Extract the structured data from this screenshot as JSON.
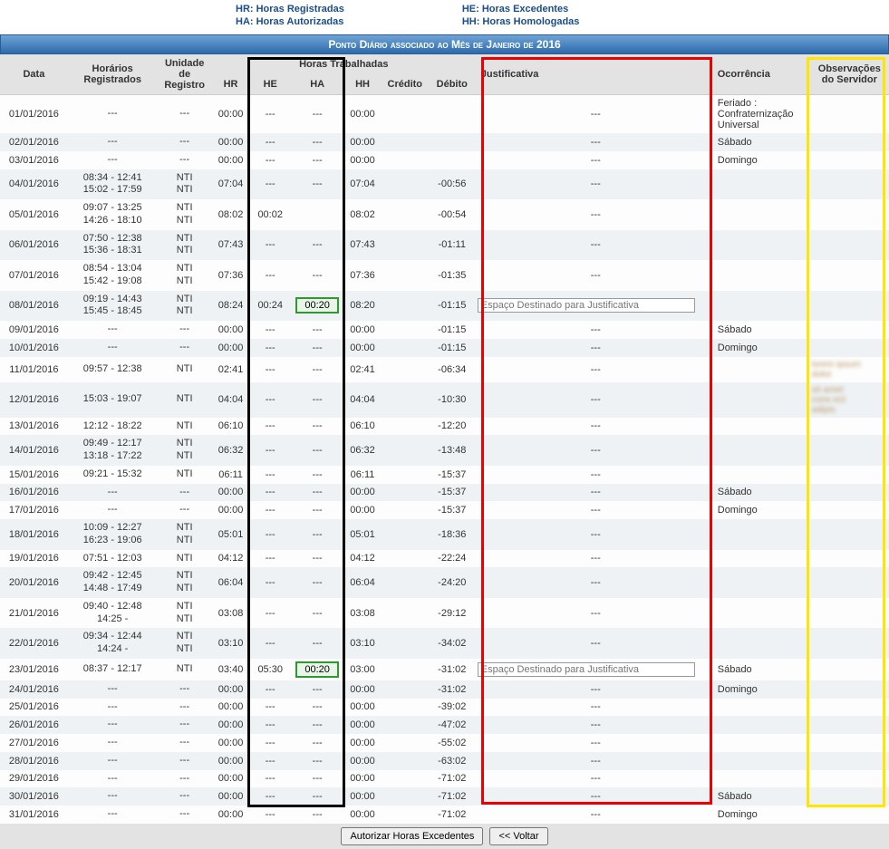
{
  "legend": {
    "hr": "HR: Horas Registradas",
    "ha": "HA: Horas Autorizadas",
    "he": "HE: Horas Excedentes",
    "hh": "HH: Horas Homologadas"
  },
  "title": "Ponto Diário associado ao Mês de Janeiro de 2016",
  "headers": {
    "data": "Data",
    "horarios": "Horários Registrados",
    "unidade": "Unidade de Registro",
    "horas_trab": "Horas Trabalhadas",
    "hr": "HR",
    "he": "HE",
    "ha": "HA",
    "hh": "HH",
    "credito": "Crédito",
    "debito": "Débito",
    "justificativa": "Justificativa",
    "ocorrencia": "Ocorrência",
    "observacoes": "Observações do Servidor"
  },
  "justificativa_placeholder": "Espaço Destinado para Justificativa",
  "buttons": {
    "autorizar": "Autorizar Horas Excedentes",
    "voltar": "<< Voltar"
  },
  "rows": [
    {
      "data": "01/01/2016",
      "hor1": "---",
      "hor2": "",
      "un1": "---",
      "un2": "",
      "hr": "00:00",
      "he": "---",
      "ha": "---",
      "ha_input": false,
      "hh": "00:00",
      "cred": "",
      "deb": "",
      "just": "---",
      "just_input": false,
      "ocor": "Feriado : Confraternização Universal",
      "obs": ""
    },
    {
      "data": "02/01/2016",
      "hor1": "---",
      "hor2": "",
      "un1": "---",
      "un2": "",
      "hr": "00:00",
      "he": "---",
      "ha": "---",
      "ha_input": false,
      "hh": "00:00",
      "cred": "",
      "deb": "",
      "just": "---",
      "just_input": false,
      "ocor": "Sábado",
      "obs": ""
    },
    {
      "data": "03/01/2016",
      "hor1": "---",
      "hor2": "",
      "un1": "---",
      "un2": "",
      "hr": "00:00",
      "he": "---",
      "ha": "---",
      "ha_input": false,
      "hh": "00:00",
      "cred": "",
      "deb": "",
      "just": "---",
      "just_input": false,
      "ocor": "Domingo",
      "obs": ""
    },
    {
      "data": "04/01/2016",
      "hor1": "08:34 - 12:41",
      "hor2": "15:02 - 17:59",
      "un1": "NTI",
      "un2": "NTI",
      "hr": "07:04",
      "he": "---",
      "ha": "---",
      "ha_input": false,
      "hh": "07:04",
      "cred": "",
      "deb": "-00:56",
      "just": "---",
      "just_input": false,
      "ocor": "",
      "obs": ""
    },
    {
      "data": "05/01/2016",
      "hor1": "09:07 - 13:25",
      "hor2": "14:26 - 18:10",
      "un1": "NTI",
      "un2": "NTI",
      "hr": "08:02",
      "he": "00:02",
      "ha": "",
      "ha_input": false,
      "hh": "08:02",
      "cred": "",
      "deb": "-00:54",
      "just": "---",
      "just_input": false,
      "ocor": "",
      "obs": ""
    },
    {
      "data": "06/01/2016",
      "hor1": "07:50 - 12:38",
      "hor2": "15:36 - 18:31",
      "un1": "NTI",
      "un2": "NTI",
      "hr": "07:43",
      "he": "---",
      "ha": "---",
      "ha_input": false,
      "hh": "07:43",
      "cred": "",
      "deb": "-01:11",
      "just": "---",
      "just_input": false,
      "ocor": "",
      "obs": ""
    },
    {
      "data": "07/01/2016",
      "hor1": "08:54 - 13:04",
      "hor2": "15:42 - 19:08",
      "un1": "NTI",
      "un2": "NTI",
      "hr": "07:36",
      "he": "---",
      "ha": "---",
      "ha_input": false,
      "hh": "07:36",
      "cred": "",
      "deb": "-01:35",
      "just": "---",
      "just_input": false,
      "ocor": "",
      "obs": ""
    },
    {
      "data": "08/01/2016",
      "hor1": "09:19 - 14:43",
      "hor2": "15:45 - 18:45",
      "un1": "NTI",
      "un2": "NTI",
      "hr": "08:24",
      "he": "00:24",
      "ha": "00:20",
      "ha_input": true,
      "hh": "08:20",
      "cred": "",
      "deb": "-01:15",
      "just": "",
      "just_input": true,
      "ocor": "",
      "obs": ""
    },
    {
      "data": "09/01/2016",
      "hor1": "---",
      "hor2": "",
      "un1": "---",
      "un2": "",
      "hr": "00:00",
      "he": "---",
      "ha": "---",
      "ha_input": false,
      "hh": "00:00",
      "cred": "",
      "deb": "-01:15",
      "just": "---",
      "just_input": false,
      "ocor": "Sábado",
      "obs": ""
    },
    {
      "data": "10/01/2016",
      "hor1": "---",
      "hor2": "",
      "un1": "---",
      "un2": "",
      "hr": "00:00",
      "he": "---",
      "ha": "---",
      "ha_input": false,
      "hh": "00:00",
      "cred": "",
      "deb": "-01:15",
      "just": "---",
      "just_input": false,
      "ocor": "Domingo",
      "obs": ""
    },
    {
      "data": "11/01/2016",
      "hor1": "09:57 - 12:38",
      "hor2": "",
      "un1": "NTI",
      "un2": "",
      "hr": "02:41",
      "he": "---",
      "ha": "---",
      "ha_input": false,
      "hh": "02:41",
      "cred": "",
      "deb": "-06:34",
      "just": "---",
      "just_input": false,
      "ocor": "",
      "obs": "blur1"
    },
    {
      "data": "12/01/2016",
      "hor1": "15:03 - 19:07",
      "hor2": "",
      "un1": "NTI",
      "un2": "",
      "hr": "04:04",
      "he": "---",
      "ha": "---",
      "ha_input": false,
      "hh": "04:04",
      "cred": "",
      "deb": "-10:30",
      "just": "---",
      "just_input": false,
      "ocor": "",
      "obs": "blur2"
    },
    {
      "data": "13/01/2016",
      "hor1": "12:12 - 18:22",
      "hor2": "",
      "un1": "NTI",
      "un2": "",
      "hr": "06:10",
      "he": "---",
      "ha": "---",
      "ha_input": false,
      "hh": "06:10",
      "cred": "",
      "deb": "-12:20",
      "just": "---",
      "just_input": false,
      "ocor": "",
      "obs": ""
    },
    {
      "data": "14/01/2016",
      "hor1": "09:49 - 12:17",
      "hor2": "13:18 - 17:22",
      "un1": "NTI",
      "un2": "NTI",
      "hr": "06:32",
      "he": "---",
      "ha": "---",
      "ha_input": false,
      "hh": "06:32",
      "cred": "",
      "deb": "-13:48",
      "just": "---",
      "just_input": false,
      "ocor": "",
      "obs": ""
    },
    {
      "data": "15/01/2016",
      "hor1": "09:21 - 15:32",
      "hor2": "",
      "un1": "NTI",
      "un2": "",
      "hr": "06:11",
      "he": "---",
      "ha": "---",
      "ha_input": false,
      "hh": "06:11",
      "cred": "",
      "deb": "-15:37",
      "just": "---",
      "just_input": false,
      "ocor": "",
      "obs": ""
    },
    {
      "data": "16/01/2016",
      "hor1": "---",
      "hor2": "",
      "un1": "---",
      "un2": "",
      "hr": "00:00",
      "he": "---",
      "ha": "---",
      "ha_input": false,
      "hh": "00:00",
      "cred": "",
      "deb": "-15:37",
      "just": "---",
      "just_input": false,
      "ocor": "Sábado",
      "obs": ""
    },
    {
      "data": "17/01/2016",
      "hor1": "---",
      "hor2": "",
      "un1": "---",
      "un2": "",
      "hr": "00:00",
      "he": "---",
      "ha": "---",
      "ha_input": false,
      "hh": "00:00",
      "cred": "",
      "deb": "-15:37",
      "just": "---",
      "just_input": false,
      "ocor": "Domingo",
      "obs": ""
    },
    {
      "data": "18/01/2016",
      "hor1": "10:09 - 12:27",
      "hor2": "16:23 - 19:06",
      "un1": "NTI",
      "un2": "NTI",
      "hr": "05:01",
      "he": "---",
      "ha": "---",
      "ha_input": false,
      "hh": "05:01",
      "cred": "",
      "deb": "-18:36",
      "just": "---",
      "just_input": false,
      "ocor": "",
      "obs": ""
    },
    {
      "data": "19/01/2016",
      "hor1": "07:51 - 12:03",
      "hor2": "",
      "un1": "NTI",
      "un2": "",
      "hr": "04:12",
      "he": "---",
      "ha": "---",
      "ha_input": false,
      "hh": "04:12",
      "cred": "",
      "deb": "-22:24",
      "just": "---",
      "just_input": false,
      "ocor": "",
      "obs": ""
    },
    {
      "data": "20/01/2016",
      "hor1": "09:42 - 12:45",
      "hor2": "14:48 - 17:49",
      "un1": "NTI",
      "un2": "NTI",
      "hr": "06:04",
      "he": "---",
      "ha": "---",
      "ha_input": false,
      "hh": "06:04",
      "cred": "",
      "deb": "-24:20",
      "just": "---",
      "just_input": false,
      "ocor": "",
      "obs": ""
    },
    {
      "data": "21/01/2016",
      "hor1": "09:40 - 12:48",
      "hor2": "14:25 -",
      "un1": "NTI",
      "un2": "NTI",
      "hr": "03:08",
      "he": "---",
      "ha": "---",
      "ha_input": false,
      "hh": "03:08",
      "cred": "",
      "deb": "-29:12",
      "just": "---",
      "just_input": false,
      "ocor": "",
      "obs": ""
    },
    {
      "data": "22/01/2016",
      "hor1": "09:34 - 12:44",
      "hor2": "14:24 -",
      "un1": "NTI",
      "un2": "NTI",
      "hr": "03:10",
      "he": "---",
      "ha": "---",
      "ha_input": false,
      "hh": "03:10",
      "cred": "",
      "deb": "-34:02",
      "just": "---",
      "just_input": false,
      "ocor": "",
      "obs": ""
    },
    {
      "data": "23/01/2016",
      "hor1": "08:37 - 12:17",
      "hor2": "",
      "un1": "NTI",
      "un2": "",
      "hr": "03:40",
      "he": "05:30",
      "ha": "00:20",
      "ha_input": true,
      "hh": "03:00",
      "cred": "",
      "deb": "-31:02",
      "just": "",
      "just_input": true,
      "ocor": "Sábado",
      "obs": ""
    },
    {
      "data": "24/01/2016",
      "hor1": "---",
      "hor2": "",
      "un1": "---",
      "un2": "",
      "hr": "00:00",
      "he": "---",
      "ha": "---",
      "ha_input": false,
      "hh": "00:00",
      "cred": "",
      "deb": "-31:02",
      "just": "---",
      "just_input": false,
      "ocor": "Domingo",
      "obs": ""
    },
    {
      "data": "25/01/2016",
      "hor1": "---",
      "hor2": "",
      "un1": "---",
      "un2": "",
      "hr": "00:00",
      "he": "---",
      "ha": "---",
      "ha_input": false,
      "hh": "00:00",
      "cred": "",
      "deb": "-39:02",
      "just": "---",
      "just_input": false,
      "ocor": "",
      "obs": ""
    },
    {
      "data": "26/01/2016",
      "hor1": "---",
      "hor2": "",
      "un1": "---",
      "un2": "",
      "hr": "00:00",
      "he": "---",
      "ha": "---",
      "ha_input": false,
      "hh": "00:00",
      "cred": "",
      "deb": "-47:02",
      "just": "---",
      "just_input": false,
      "ocor": "",
      "obs": ""
    },
    {
      "data": "27/01/2016",
      "hor1": "---",
      "hor2": "",
      "un1": "---",
      "un2": "",
      "hr": "00:00",
      "he": "---",
      "ha": "---",
      "ha_input": false,
      "hh": "00:00",
      "cred": "",
      "deb": "-55:02",
      "just": "---",
      "just_input": false,
      "ocor": "",
      "obs": ""
    },
    {
      "data": "28/01/2016",
      "hor1": "---",
      "hor2": "",
      "un1": "---",
      "un2": "",
      "hr": "00:00",
      "he": "---",
      "ha": "---",
      "ha_input": false,
      "hh": "00:00",
      "cred": "",
      "deb": "-63:02",
      "just": "---",
      "just_input": false,
      "ocor": "",
      "obs": ""
    },
    {
      "data": "29/01/2016",
      "hor1": "---",
      "hor2": "",
      "un1": "---",
      "un2": "",
      "hr": "00:00",
      "he": "---",
      "ha": "---",
      "ha_input": false,
      "hh": "00:00",
      "cred": "",
      "deb": "-71:02",
      "just": "---",
      "just_input": false,
      "ocor": "",
      "obs": ""
    },
    {
      "data": "30/01/2016",
      "hor1": "---",
      "hor2": "",
      "un1": "---",
      "un2": "",
      "hr": "00:00",
      "he": "---",
      "ha": "---",
      "ha_input": false,
      "hh": "00:00",
      "cred": "",
      "deb": "-71:02",
      "just": "---",
      "just_input": false,
      "ocor": "Sábado",
      "obs": ""
    },
    {
      "data": "31/01/2016",
      "hor1": "---",
      "hor2": "",
      "un1": "---",
      "un2": "",
      "hr": "00:00",
      "he": "---",
      "ha": "---",
      "ha_input": false,
      "hh": "00:00",
      "cred": "",
      "deb": "-71:02",
      "just": "---",
      "just_input": false,
      "ocor": "Domingo",
      "obs": ""
    }
  ]
}
